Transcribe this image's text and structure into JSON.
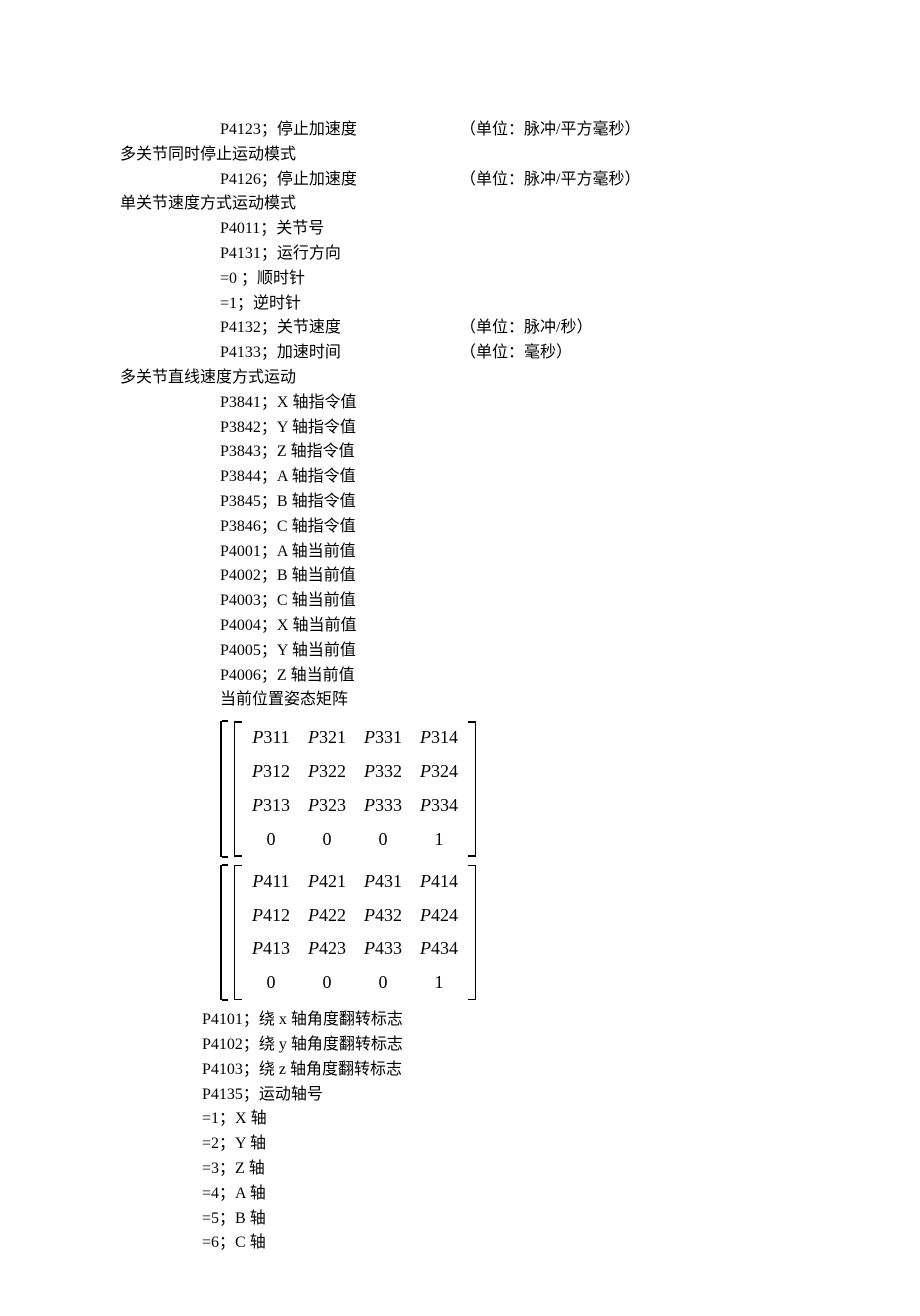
{
  "lines": [
    {
      "indent": "indent1",
      "c1": "P4123；停止加速度",
      "c2": "（单位：脉冲/平方毫秒）"
    },
    {
      "indent": "indent0",
      "c1": "多关节同时停止运动模式",
      "c2": ""
    },
    {
      "indent": "indent1",
      "c1": "P4126；停止加速度",
      "c2": "（单位：脉冲/平方毫秒）"
    },
    {
      "indent": "indent0",
      "c1": "单关节速度方式运动模式",
      "c2": ""
    },
    {
      "indent": "indent1",
      "c1": "P4011；关节号",
      "c2": ""
    },
    {
      "indent": "indent1",
      "c1": "P4131；运行方向",
      "c2": ""
    },
    {
      "indent": "indent1",
      "c1": "=0  ；顺时针",
      "c2": ""
    },
    {
      "indent": "indent1",
      "c1": "=1；逆时针",
      "c2": ""
    },
    {
      "indent": "indent1",
      "c1": "P4132；关节速度",
      "c2": "（单位：脉冲/秒）"
    },
    {
      "indent": "indent1",
      "c1": "P4133；加速时间",
      "c2": "（单位：毫秒）"
    },
    {
      "indent": "indent0",
      "c1": "多关节直线速度方式运动",
      "c2": ""
    },
    {
      "indent": "indent1",
      "c1": "P3841；X 轴指令值",
      "c2": ""
    },
    {
      "indent": "indent1",
      "c1": "P3842；Y 轴指令值",
      "c2": ""
    },
    {
      "indent": "indent1",
      "c1": "P3843；Z 轴指令值",
      "c2": ""
    },
    {
      "indent": "indent1",
      "c1": "P3844；A 轴指令值",
      "c2": ""
    },
    {
      "indent": "indent1",
      "c1": "P3845；B 轴指令值",
      "c2": ""
    },
    {
      "indent": "indent1",
      "c1": "P3846；C 轴指令值",
      "c2": ""
    },
    {
      "indent": "indent1",
      "c1": "P4001；A 轴当前值",
      "c2": ""
    },
    {
      "indent": "indent1",
      "c1": "P4002；B 轴当前值",
      "c2": ""
    },
    {
      "indent": "indent1",
      "c1": "P4003；C 轴当前值",
      "c2": ""
    },
    {
      "indent": "indent1",
      "c1": "P4004；X 轴当前值",
      "c2": ""
    },
    {
      "indent": "indent1",
      "c1": "P4005；Y 轴当前值",
      "c2": ""
    },
    {
      "indent": "indent1",
      "c1": "P4006；Z 轴当前值",
      "c2": ""
    },
    {
      "indent": "indent1",
      "c1": "当前位置姿态矩阵",
      "c2": ""
    }
  ],
  "matrix1": [
    [
      "P311",
      "P321",
      "P331",
      "P314"
    ],
    [
      "P312",
      "P322",
      "P332",
      "P324"
    ],
    [
      "P313",
      "P323",
      "P333",
      "P334"
    ],
    [
      "0",
      "0",
      "0",
      "1"
    ]
  ],
  "matrix2": [
    [
      "P411",
      "P421",
      "P431",
      "P414"
    ],
    [
      "P412",
      "P422",
      "P432",
      "P424"
    ],
    [
      "P413",
      "P423",
      "P433",
      "P434"
    ],
    [
      "0",
      "0",
      "0",
      "1"
    ]
  ],
  "lines2": [
    {
      "indent": "indent-half",
      "c1": "P4101；绕 x 轴角度翻转标志",
      "c2": ""
    },
    {
      "indent": "indent-half",
      "c1": "P4102；绕 y 轴角度翻转标志",
      "c2": ""
    },
    {
      "indent": "indent-half",
      "c1": "P4103；绕 z 轴角度翻转标志",
      "c2": ""
    },
    {
      "indent": "indent-half",
      "c1": "P4135；运动轴号",
      "c2": ""
    },
    {
      "indent": "indent-half",
      "c1": "=1；X 轴",
      "c2": ""
    },
    {
      "indent": "indent-half",
      "c1": "=2；Y 轴",
      "c2": ""
    },
    {
      "indent": "indent-half",
      "c1": "=3；Z 轴",
      "c2": ""
    },
    {
      "indent": "indent-half",
      "c1": "=4；A 轴",
      "c2": ""
    },
    {
      "indent": "indent-half",
      "c1": "=5；B 轴",
      "c2": ""
    },
    {
      "indent": "indent-half",
      "c1": "=6；C 轴",
      "c2": ""
    }
  ]
}
